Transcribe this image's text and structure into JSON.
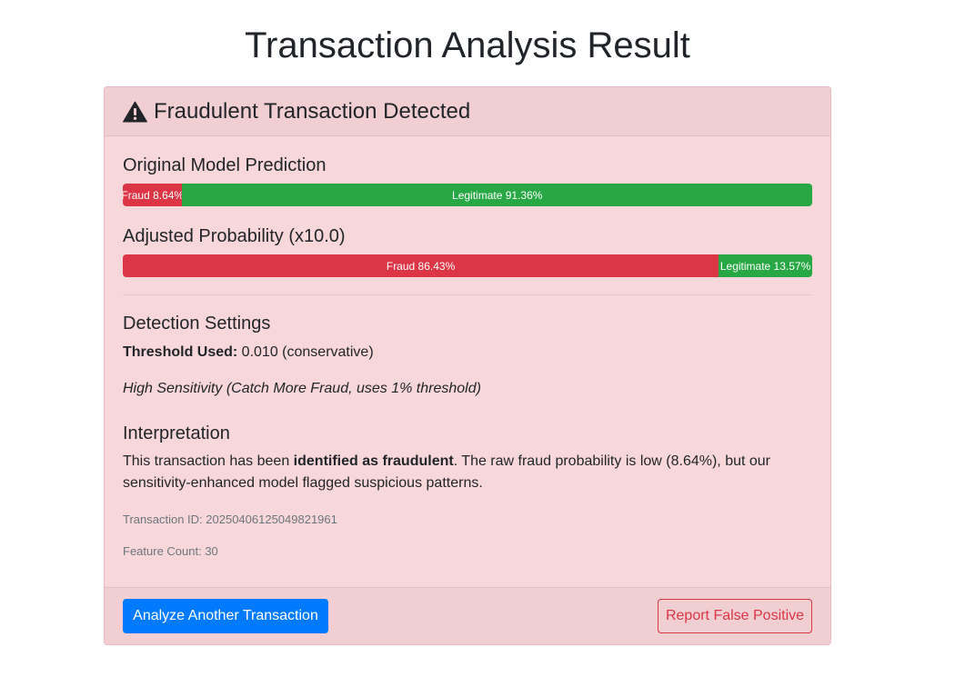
{
  "page": {
    "title": "Transaction Analysis Result"
  },
  "card": {
    "header_title": "Fraudulent Transaction Detected",
    "header_icon": "warning-triangle-icon",
    "original": {
      "title": "Original Model Prediction",
      "fraud_label": "Fraud 8.64%",
      "legit_label": "Legitimate 91.36%",
      "fraud_pct": 8.64,
      "legit_pct": 91.36
    },
    "adjusted": {
      "title": "Adjusted Probability (x10.0)",
      "fraud_label": "Fraud 86.43%",
      "legit_label": "Legitimate 13.57%",
      "fraud_pct": 86.43,
      "legit_pct": 13.57
    },
    "settings": {
      "title": "Detection Settings",
      "threshold_label": "Threshold Used:",
      "threshold_value": " 0.010 (conservative)",
      "mode_text": "High Sensitivity (Catch More Fraud, uses 1% threshold)"
    },
    "interpretation": {
      "title": "Interpretation",
      "text_before": "This transaction has been ",
      "text_bold": "identified as fraudulent",
      "text_after": ". The raw fraud probability is low (8.64%), but our sensitivity-enhanced model flagged suspicious patterns."
    },
    "transaction_id": "Transaction ID: 20250406125049821961",
    "feature_count": "Feature Count: 30"
  },
  "footer": {
    "analyze_button": "Analyze Another Transaction",
    "report_button": "Report False Positive"
  },
  "colors": {
    "fraud": "#dc3545",
    "legit": "#28a745",
    "primary": "#007bff",
    "card_bg": "#f8d7da"
  }
}
